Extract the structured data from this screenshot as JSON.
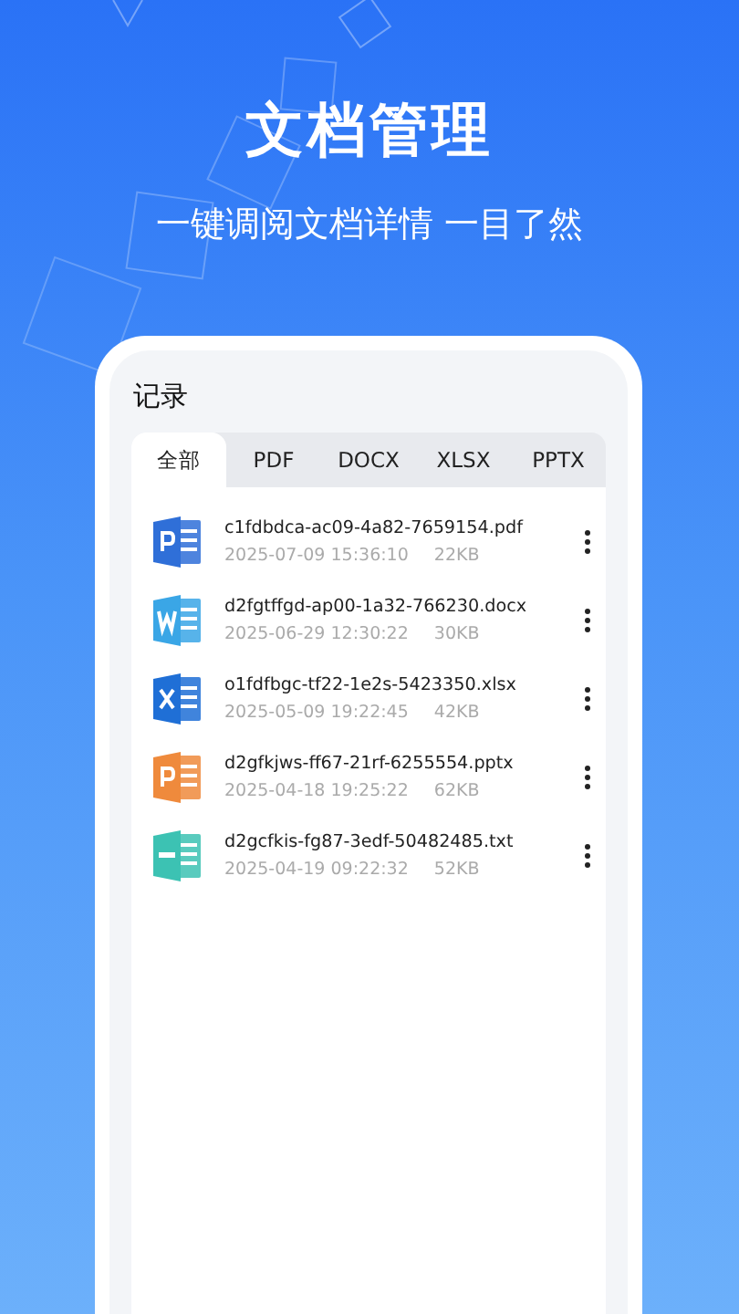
{
  "headline": "文档管理",
  "subtitle": "一键调阅文档详情 一目了然",
  "screen_title": "记录",
  "tabs": [
    {
      "label": "全部",
      "selected": true
    },
    {
      "label": "PDF",
      "selected": false
    },
    {
      "label": "DOCX",
      "selected": false
    },
    {
      "label": "XLSX",
      "selected": false
    },
    {
      "label": "PPTX",
      "selected": false
    }
  ],
  "files": [
    {
      "kind": "pdf",
      "name": "c1fdbdca-ac09-4a82-7659154.pdf",
      "time": "2025-07-09 15:36:10",
      "size": "22KB"
    },
    {
      "kind": "docx",
      "name": "d2fgtffgd-ap00-1a32-766230.docx",
      "time": "2025-06-29 12:30:22",
      "size": "30KB"
    },
    {
      "kind": "xlsx",
      "name": "o1fdfbgc-tf22-1e2s-5423350.xlsx",
      "time": "2025-05-09 19:22:45",
      "size": "42KB"
    },
    {
      "kind": "pptx",
      "name": "d2gfkjws-ff67-21rf-6255554.pptx",
      "time": "2025-04-18 19:25:22",
      "size": "62KB"
    },
    {
      "kind": "txt",
      "name": "d2gcfkis-fg87-3edf-50482485.txt",
      "time": "2025-04-19 09:22:32",
      "size": "52KB"
    }
  ]
}
